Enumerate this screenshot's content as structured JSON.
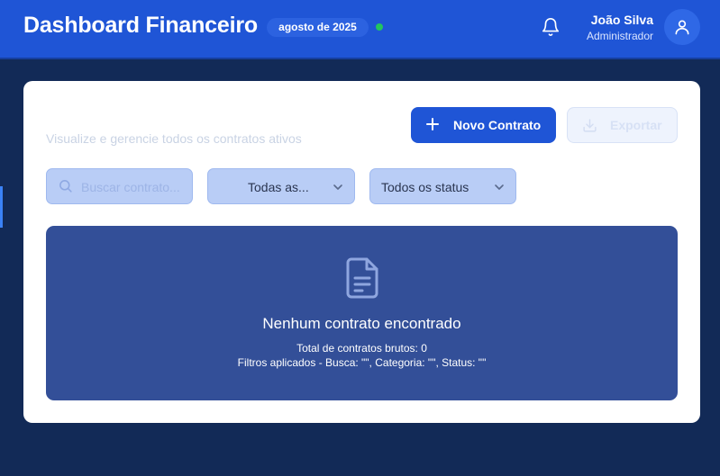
{
  "header": {
    "title": "Dashboard Financeiro",
    "period_badge": "agosto de 2025",
    "notifications_icon": "bell-icon",
    "user": {
      "name": "João Silva",
      "role": "Administrador",
      "avatar_icon": "user-icon"
    }
  },
  "colors": {
    "header_bg": "#1f55d6",
    "page_bg": "#122a57",
    "primary": "#1f55d6",
    "status_online": "#22c55e",
    "empty_panel": "#334f98"
  },
  "main": {
    "subtitle": "Visualize e gerencie todos os contratos ativos",
    "actions": {
      "new_contract_label": "Novo Contrato",
      "new_contract_icon": "plus-icon",
      "export_label": "Exportar",
      "export_icon": "download-icon"
    },
    "filters": {
      "search_placeholder": "Buscar contrato...",
      "search_value": "",
      "search_icon": "search-icon",
      "category_selected": "Todas as...",
      "status_selected": "Todos os status"
    },
    "empty_state": {
      "icon": "document-icon",
      "title": "Nenhum contrato encontrado",
      "raw_count": "Total de contratos brutos: 0",
      "filters_applied": "Filtros aplicados - Busca: \"\", Categoria: \"\", Status: \"\""
    }
  }
}
